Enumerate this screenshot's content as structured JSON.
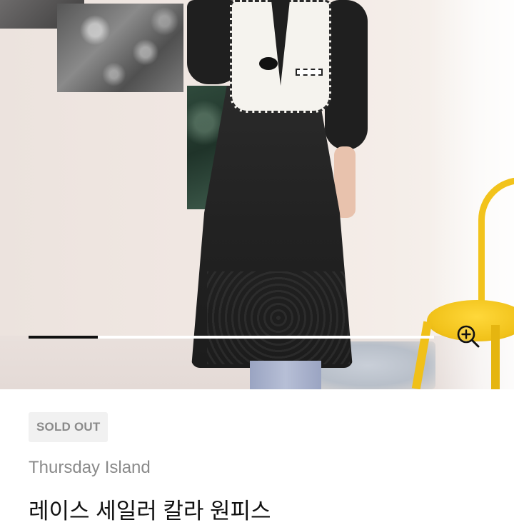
{
  "gallery": {
    "progress": 0.17,
    "zoom_icon": "zoom-in-icon"
  },
  "product": {
    "status_badge": "SOLD OUT",
    "brand": "Thursday Island",
    "title": "레이스 세일러 칼라 원피스"
  },
  "colors": {
    "badge_bg": "#f1f1f1",
    "muted_text": "#8a8a8a",
    "title_text": "#111111",
    "progress_fill": "#111111",
    "progress_track": "#ffffff"
  }
}
